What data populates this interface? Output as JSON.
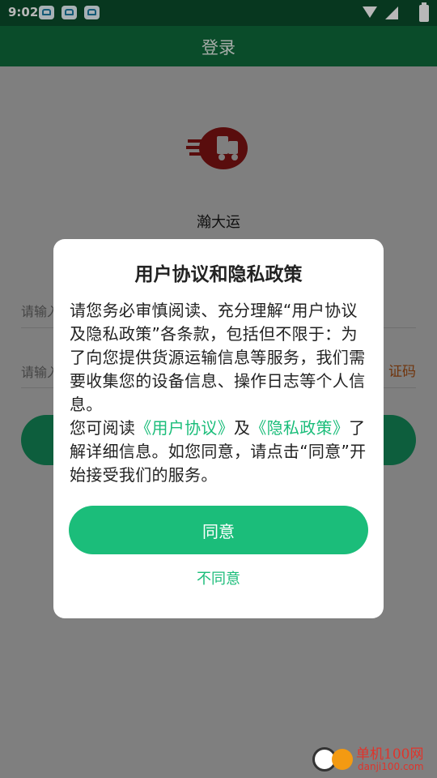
{
  "status_bar": {
    "time": "9:02"
  },
  "app_bar": {
    "title": "登录"
  },
  "login": {
    "app_name": "瀚大运",
    "phone_hint": "请输入",
    "code_hint": "请输入",
    "get_code": "证码"
  },
  "dialog": {
    "title": "用户协议和隐私政策",
    "para1": "请您务必审慎阅读、充分理解“用户协议及隐私政策”各条款，包括但不限于：为了向您提供货源运输信息等服务，我们需要收集您的设备信息、操作日志等个人信息。",
    "para2_prefix": "您可阅读",
    "link_user": "《用户协议》",
    "para2_mid": "及",
    "link_privacy": "《隐私政策》",
    "para2_suffix": "了解详细信息。如您同意，请点击“同意”开始接受我们的服务。",
    "agree": "同意",
    "disagree": "不同意"
  },
  "watermark": {
    "name": "单机100网",
    "url": "danji100.com"
  },
  "colors": {
    "accent": "#1bbd7a",
    "app_bar": "#0f6a3b",
    "status_bar": "#0b4d2c"
  }
}
